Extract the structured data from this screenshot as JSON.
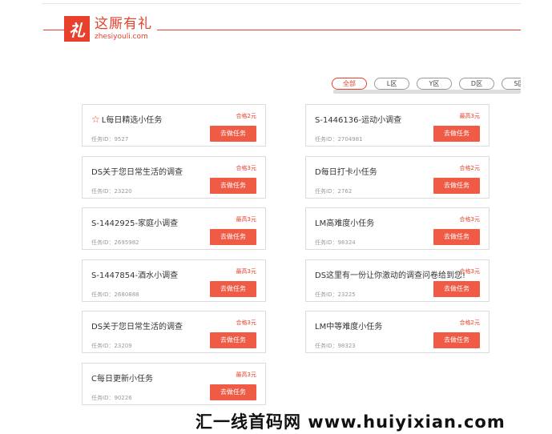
{
  "logo": {
    "mark": "礼",
    "name": "这厮有礼",
    "domain": "zhesiyouli.com"
  },
  "tabs": [
    {
      "label": "全部",
      "active": true
    },
    {
      "label": "L区",
      "active": false
    },
    {
      "label": "Y区",
      "active": false
    },
    {
      "label": "D区",
      "active": false
    },
    {
      "label": "S区",
      "active": false
    }
  ],
  "button_label": "去做任务",
  "left_cards": [
    {
      "title": "L每日精选小任务",
      "badge": "合格2元",
      "id": "任务ID：9527",
      "starred": true
    },
    {
      "title": "DS关于您日常生活的调查",
      "badge": "合格3元",
      "id": "任务ID：23220"
    },
    {
      "title": "S-1442925-家庭小调查",
      "badge": "最高3元",
      "id": "任务ID：2695982"
    },
    {
      "title": "S-1447854-酒水小调查",
      "badge": "最高3元",
      "id": "任务ID：2680888"
    },
    {
      "title": "DS关于您日常生活的调查",
      "badge": "合格3元",
      "id": "任务ID：23209"
    },
    {
      "title": "C每日更新小任务",
      "badge": "最高3元",
      "id": "任务ID：90226"
    }
  ],
  "right_cards": [
    {
      "title": "S-1446136-运动小调查",
      "badge": "最高3元",
      "id": "任务ID：2704981"
    },
    {
      "title": "D每日打卡小任务",
      "badge": "合格2元",
      "id": "任务ID：2762"
    },
    {
      "title": "LM高难度小任务",
      "badge": "合格3元",
      "id": "任务ID：98324"
    },
    {
      "title": "DS这里有一份让你激动的调查问卷给到您!",
      "badge": "合格3元",
      "id": "任务ID：23225"
    },
    {
      "title": "LM中等难度小任务",
      "badge": "合格2元",
      "id": "任务ID：98323"
    }
  ],
  "watermark": "汇一线首码网 www.huiyixian.com"
}
